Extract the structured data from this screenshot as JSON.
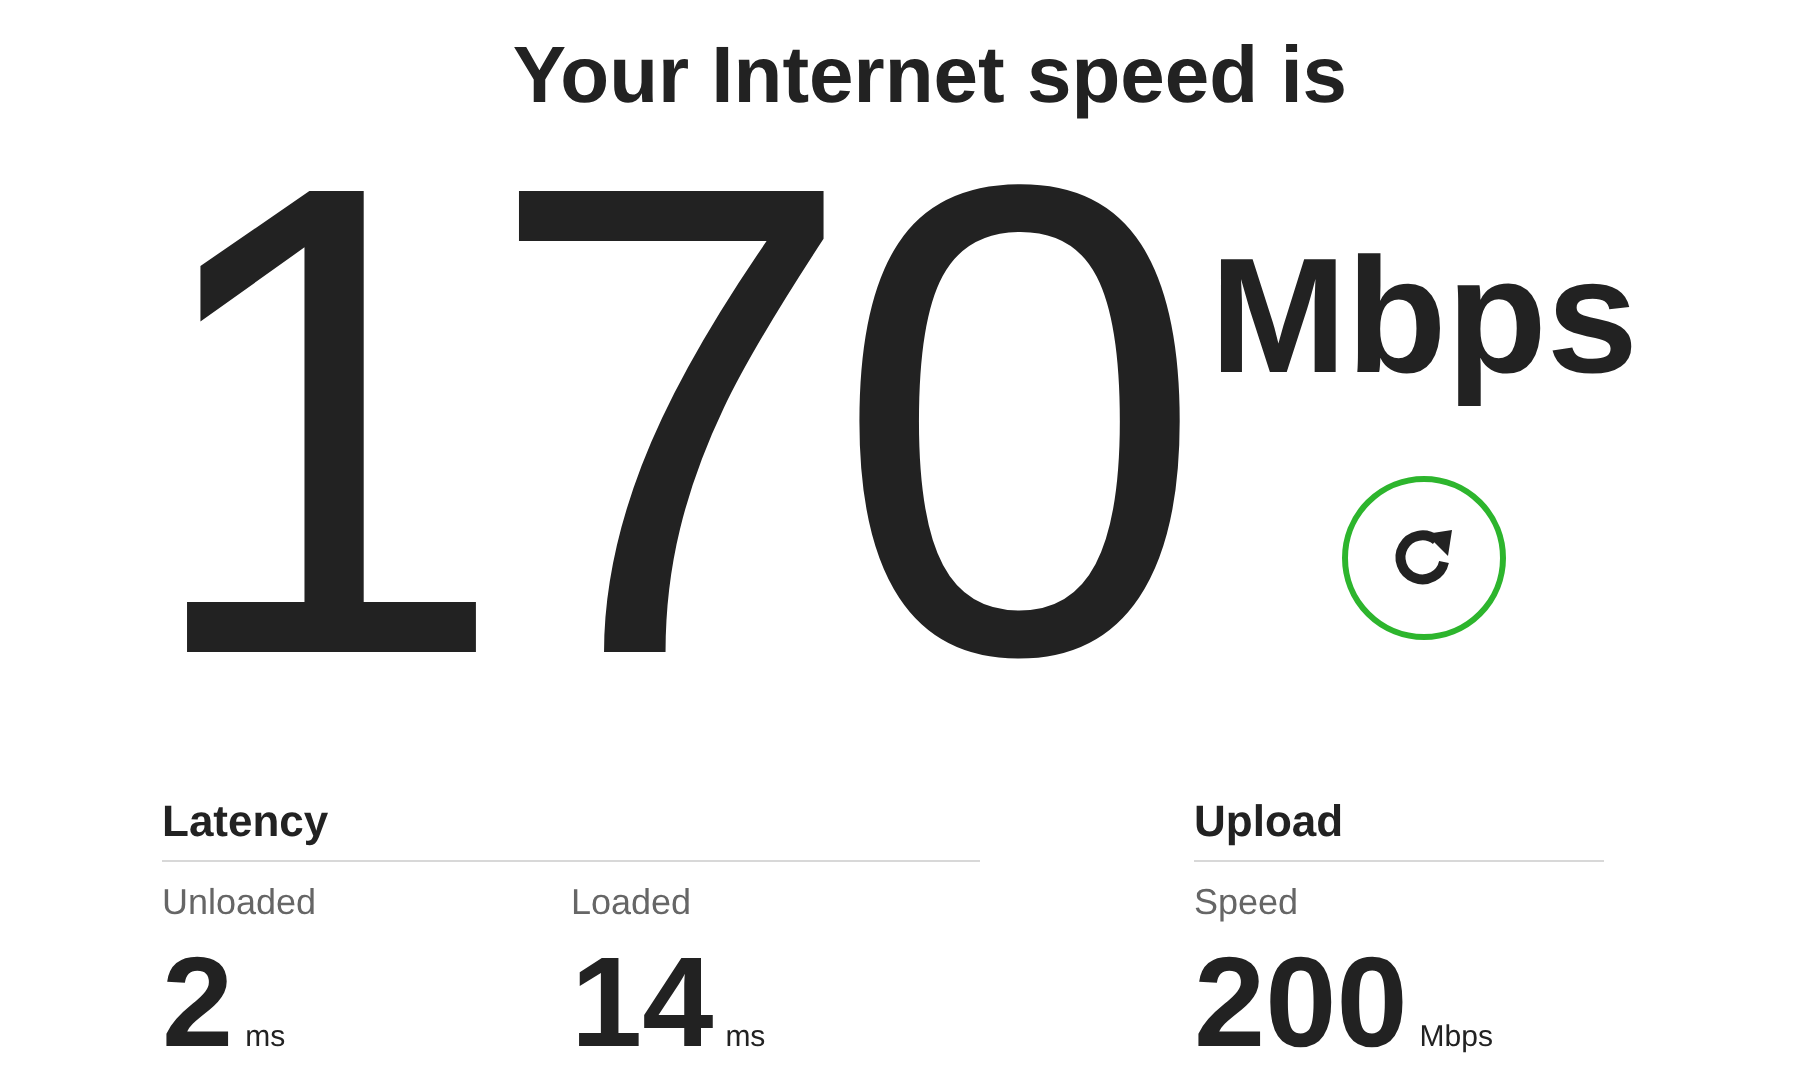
{
  "title": "Your Internet speed is",
  "speed": {
    "value": "170",
    "unit": "Mbps"
  },
  "groups": [
    {
      "heading": "Latency",
      "metrics": [
        {
          "label": "Unloaded",
          "value": "2",
          "unit": "ms"
        },
        {
          "label": "Loaded",
          "value": "14",
          "unit": "ms"
        }
      ]
    },
    {
      "heading": "Upload",
      "metrics": [
        {
          "label": "Speed",
          "value": "200",
          "unit": "Mbps"
        }
      ]
    }
  ]
}
